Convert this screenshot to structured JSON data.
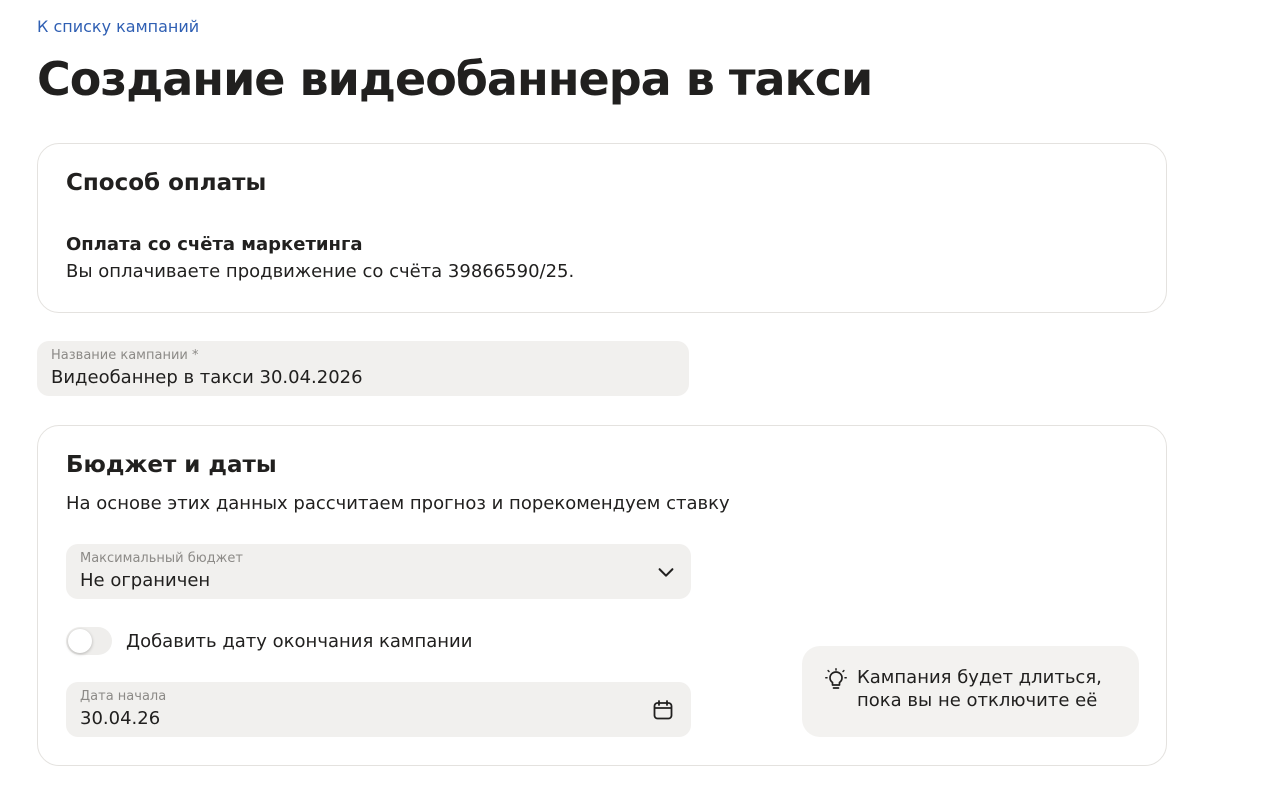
{
  "navigation": {
    "back_link": "К списку кампаний"
  },
  "page": {
    "title": "Создание видеобаннера в такси"
  },
  "payment": {
    "title": "Способ оплаты",
    "method": "Оплата со счёта маркетинга",
    "description": "Вы оплачиваете продвижение со счёта 39866590/25."
  },
  "campaign_name": {
    "label": "Название кампании *",
    "value": "Видеобаннер в такси 30.04.2026"
  },
  "budget": {
    "title": "Бюджет и даты",
    "subtitle": "На основе этих данных рассчитаем прогноз и порекомендуем ставку",
    "max_budget": {
      "label": "Максимальный бюджет",
      "value": "Не ограничен",
      "icon": "chevron-down-icon"
    },
    "end_date_toggle": {
      "label": "Добавить дату окончания кампании",
      "enabled": false
    },
    "start_date": {
      "label": "Дата начала",
      "value": "30.04.26",
      "icon": "calendar-icon"
    },
    "hint": {
      "icon": "lightbulb-icon",
      "text": "Кампания будет длиться, пока вы не отключите её"
    }
  },
  "colors": {
    "link": "#2f5fb3",
    "text": "#21201f",
    "field_bg": "#f1f0ee",
    "muted_text": "#8c8a87",
    "card_border": "#e4e2df"
  }
}
